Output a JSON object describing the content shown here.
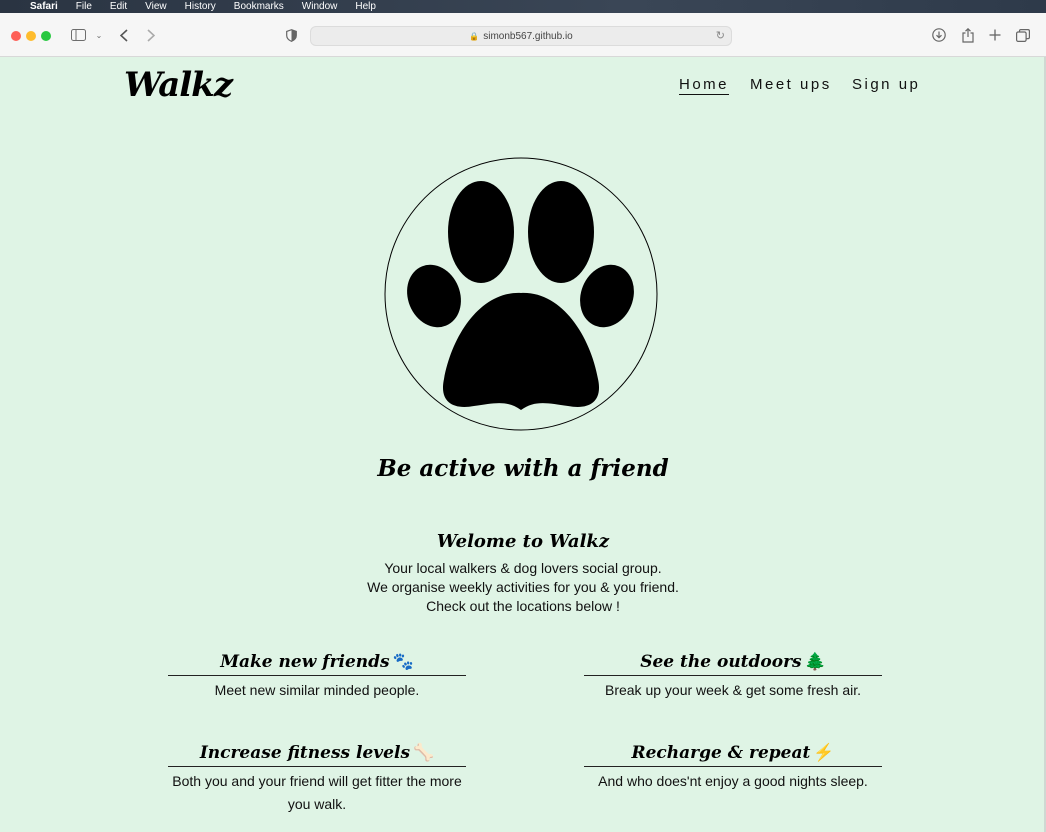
{
  "menubar": {
    "items": [
      "Safari",
      "File",
      "Edit",
      "View",
      "History",
      "Bookmarks",
      "Window",
      "Help"
    ]
  },
  "browser": {
    "url": "simonb567.github.io"
  },
  "site": {
    "logo": "Walkz",
    "nav": [
      "Home",
      "Meet ups",
      "Sign up"
    ],
    "active_nav": "Home",
    "tagline": "Be active with a friend",
    "welcome_title": "Welome to Walkz",
    "intro": [
      "Your local walkers & dog lovers social group.",
      "We organise weekly activities for you & you friend.",
      "Check out the locations below !"
    ],
    "features": [
      {
        "title": "Make new friends",
        "icon": "paw-icon",
        "glyph": "🐾",
        "text": "Meet new similar minded people."
      },
      {
        "title": "See the outdoors",
        "icon": "tree-icon",
        "glyph": "🌲",
        "text": "Break up your week & get some fresh air."
      },
      {
        "title": "Increase fitness levels",
        "icon": "bone-icon",
        "glyph": "🦴",
        "text": "Both you and your friend will get fitter the more you walk."
      },
      {
        "title": "Recharge & repeat",
        "icon": "bolt-icon",
        "glyph": "⚡",
        "text": "And who does'nt enjoy a good nights sleep."
      }
    ],
    "background_color": "#dff4e5"
  }
}
